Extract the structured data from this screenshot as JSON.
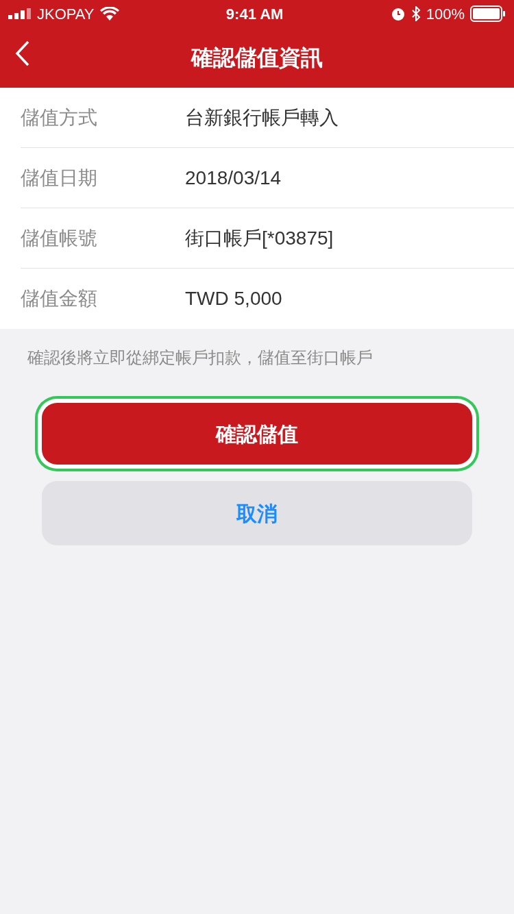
{
  "status_bar": {
    "carrier": "JKOPAY",
    "time": "9:41 AM",
    "battery": "100%"
  },
  "nav": {
    "title": "確認儲值資訊"
  },
  "rows": [
    {
      "label": "儲值方式",
      "value": "台新銀行帳戶轉入"
    },
    {
      "label": "儲值日期",
      "value": "2018/03/14"
    },
    {
      "label": "儲值帳號",
      "value": "街口帳戶[*03875]"
    },
    {
      "label": "儲值金額",
      "value": "TWD 5,000"
    }
  ],
  "note": "確認後將立即從綁定帳戶扣款，儲值至街口帳戶",
  "buttons": [
    {
      "label": "確認儲值",
      "kind": "primary",
      "highlighted": true
    },
    {
      "label": "取消",
      "kind": "secondary",
      "highlighted": false
    }
  ]
}
